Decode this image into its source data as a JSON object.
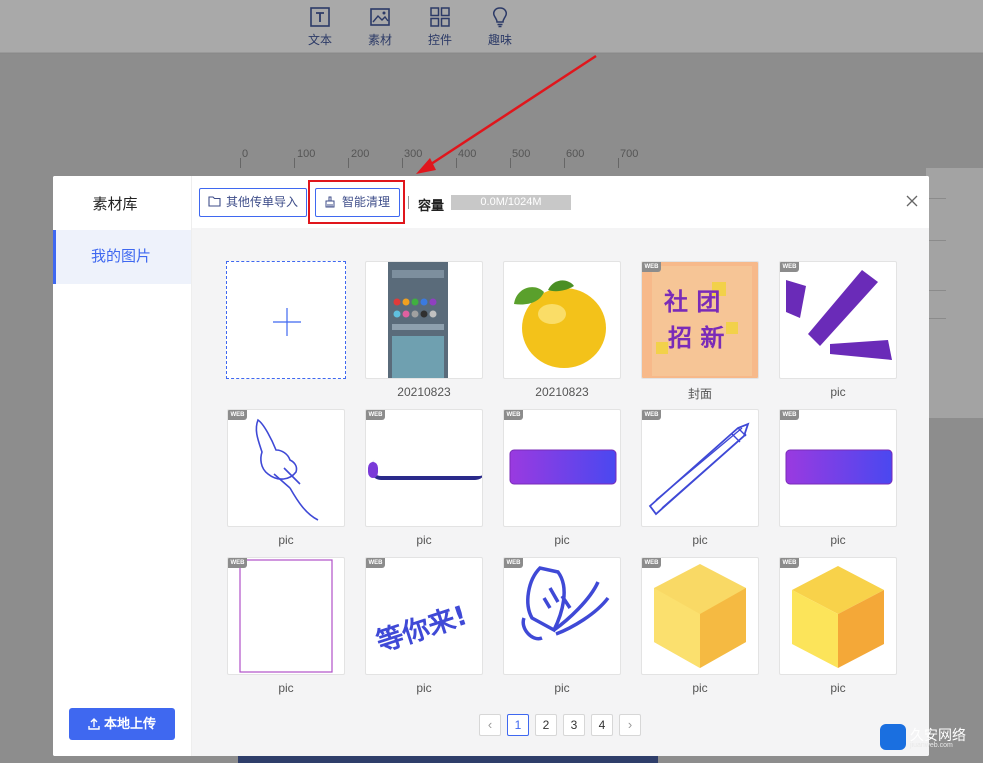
{
  "toolbar": {
    "items": [
      {
        "label": "文本",
        "icon": "text-icon"
      },
      {
        "label": "素材",
        "icon": "image-icon"
      },
      {
        "label": "控件",
        "icon": "grid-icon"
      },
      {
        "label": "趣味",
        "icon": "bulb-icon"
      }
    ]
  },
  "ruler": {
    "marks": [
      "0",
      "100",
      "200",
      "300",
      "400",
      "500",
      "600",
      "700"
    ]
  },
  "modal": {
    "sidebar": {
      "title": "素材库",
      "active_item": "我的图片",
      "upload_label": "本地上传"
    },
    "header": {
      "import_label": "其他传单导入",
      "clean_label": "智能清理",
      "capacity_label": "容量",
      "capacity_value": "0.0M/1024M",
      "capacity_used_fraction": 0.0
    },
    "items": [
      {
        "caption": "",
        "kind": "add"
      },
      {
        "caption": "20210823",
        "kind": "screenshot"
      },
      {
        "caption": "20210823",
        "kind": "lemon"
      },
      {
        "caption": "封面",
        "kind": "cover",
        "badge": "WEB"
      },
      {
        "caption": "pic",
        "kind": "stripes",
        "badge": "WEB"
      },
      {
        "caption": "pic",
        "kind": "hand",
        "badge": "WEB"
      },
      {
        "caption": "pic",
        "kind": "pill-outline",
        "badge": "WEB"
      },
      {
        "caption": "pic",
        "kind": "gradient-bar",
        "badge": "WEB"
      },
      {
        "caption": "pic",
        "kind": "pencil",
        "badge": "WEB"
      },
      {
        "caption": "pic",
        "kind": "gradient-bar",
        "badge": "WEB"
      },
      {
        "caption": "pic",
        "kind": "frame",
        "badge": "WEB"
      },
      {
        "caption": "pic",
        "kind": "handwriting",
        "badge": "WEB"
      },
      {
        "caption": "pic",
        "kind": "shuttlecock",
        "badge": "WEB"
      },
      {
        "caption": "pic",
        "kind": "cube-blur",
        "badge": "WEB"
      },
      {
        "caption": "pic",
        "kind": "cube",
        "badge": "WEB"
      }
    ],
    "pagination": {
      "pages": [
        "1",
        "2",
        "3",
        "4"
      ],
      "current": "1",
      "prev": "‹",
      "next": "›"
    }
  },
  "colors": {
    "accent": "#3f68f0",
    "highlight_box": "#e0161c",
    "purple": "#6a2bb8"
  },
  "watermark": {
    "text": "久安网络",
    "sub": "jiuanweb.com"
  }
}
